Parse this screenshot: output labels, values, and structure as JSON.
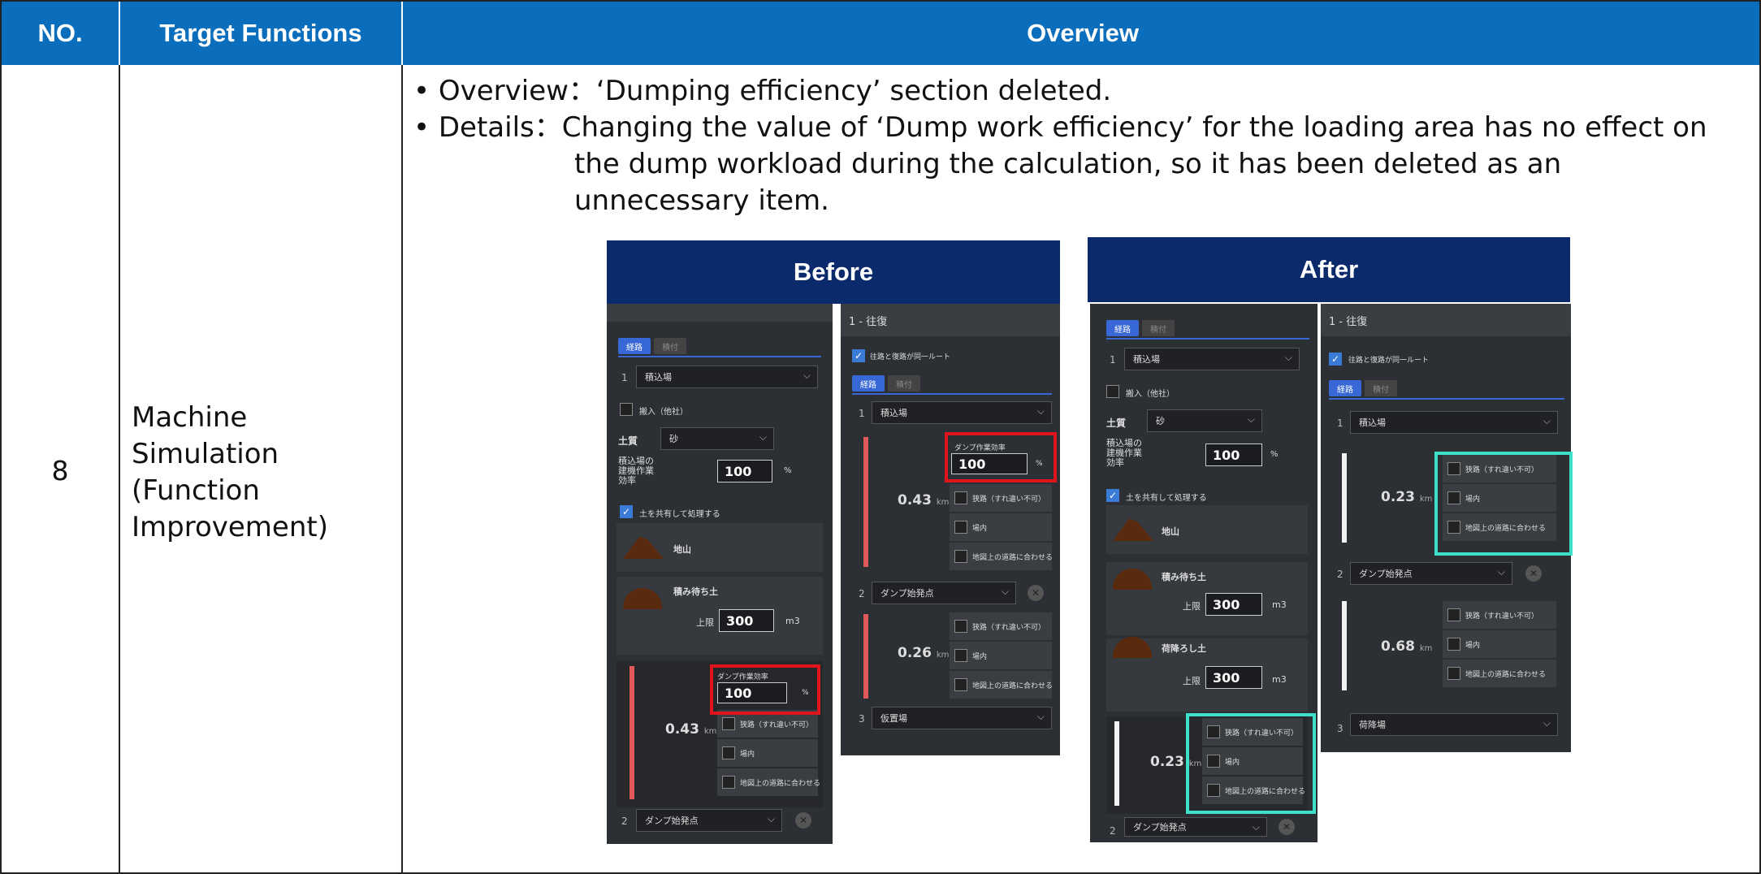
{
  "header": {
    "no": "NO.",
    "target_functions": "Target Functions",
    "overview": "Overview"
  },
  "row": {
    "no": "8",
    "target_lines": [
      "Machine",
      "Simulation",
      "(Function",
      "Improvement)"
    ],
    "overview_lines": [
      "• Overview：‘Dumping efficiency’ section deleted.",
      "• Details：Changing the value of ‘Dump work efficiency’ for the loading area has no effect on",
      "the dump workload during the calculation, so it has been deleted as an",
      "unnecessary item."
    ]
  },
  "before": {
    "banner": "Before",
    "left": {
      "tab_on": "経路",
      "tab_off": "積付",
      "area_num": "1",
      "area_select": "積込場",
      "import_label": "搬入（他社）",
      "soil_label": "土質",
      "soil_value": "砂",
      "eff_label_1": "積込場の",
      "eff_label_2": "建機作業",
      "eff_label_3": "効率",
      "eff_value": "100",
      "pct": "%",
      "share_label": "土を共有して処理する",
      "item1": "地山",
      "item2": "積み待ち土",
      "limit_label": "上限",
      "limit_value": "300",
      "limit_unit": "m3",
      "dump_eff_label": "ダンプ作業効率",
      "dump_eff_value": "100",
      "dump_eff_pct": "%",
      "dist": "0.43",
      "unit": "km",
      "opt1": "狭路（すれ違い不可）",
      "opt2": "場内",
      "opt3": "地図上の道路に合わせる",
      "next_num": "2",
      "next_select": "ダンプ始発点"
    },
    "right": {
      "title": "1 - 往復",
      "same_route": "往路と復路が同一ルート",
      "tab_on": "経路",
      "tab_off": "積付",
      "num1": "1",
      "sel1": "積込場",
      "dump_eff_label": "ダンプ作業効率",
      "dump_eff_value": "100",
      "dump_eff_pct": "%",
      "dist1": "0.43",
      "unit": "km",
      "opt1": "狭路（すれ違い不可）",
      "opt2": "場内",
      "opt3": "地図上の道路に合わせる",
      "num2": "2",
      "sel2": "ダンプ始発点",
      "dist2": "0.26",
      "num3": "3",
      "sel3": "仮置場"
    }
  },
  "after": {
    "banner": "After",
    "left": {
      "tab_on": "経路",
      "tab_off": "積付",
      "area_num": "1",
      "area_select": "積込場",
      "import_label": "搬入（他社）",
      "soil_label": "土質",
      "soil_value": "砂",
      "eff_label_1": "積込場の",
      "eff_label_2": "建機作業",
      "eff_label_3": "効率",
      "eff_value": "100",
      "pct": "%",
      "share_label": "土を共有して処理する",
      "item1": "地山",
      "item2": "積み待ち土",
      "item3": "荷降ろし土",
      "limit_label": "上限",
      "limit_value": "300",
      "limit_unit": "m3",
      "dist": "0.23",
      "unit": "km",
      "opt1": "狭路（すれ違い不可）",
      "opt2": "場内",
      "opt3": "地図上の道路に合わせる",
      "next_num": "2",
      "next_select": "ダンプ始発点"
    },
    "right": {
      "title": "1 - 往復",
      "same_route": "往路と復路が同一ルート",
      "tab_on": "経路",
      "tab_off": "積付",
      "num1": "1",
      "sel1": "積込場",
      "dist1": "0.23",
      "unit": "km",
      "opt1": "狭路（すれ違い不可）",
      "opt2": "場内",
      "opt3": "地図上の道路に合わせる",
      "num2": "2",
      "sel2": "ダンプ始発点",
      "dist2": "0.68",
      "num3": "3",
      "sel3": "荷降場"
    }
  },
  "colors": {
    "header_blue": "#0a6ebd",
    "banner_navy": "#0b2a6b",
    "highlight_red": "#e0141c",
    "highlight_teal": "#3de0c8",
    "panel_bg": "#2c2f33"
  }
}
